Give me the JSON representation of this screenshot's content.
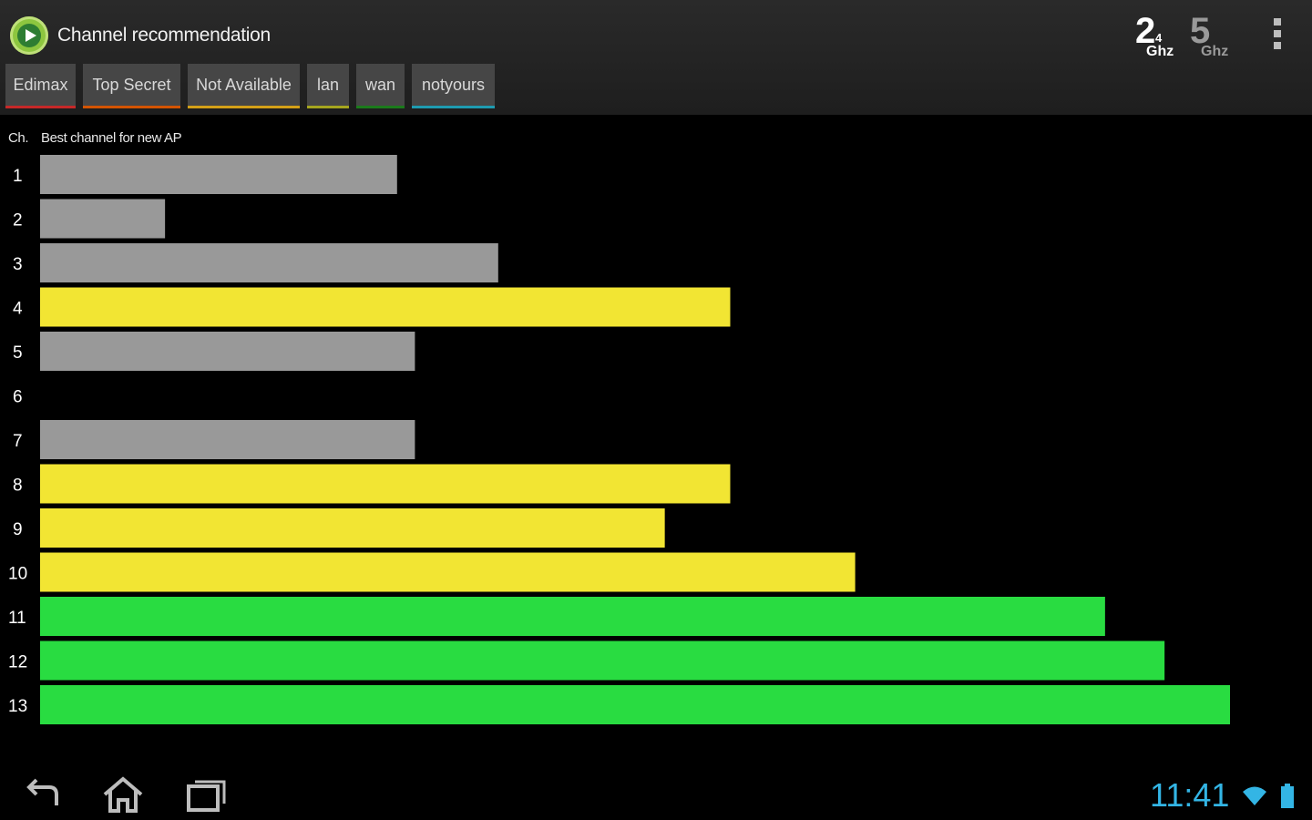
{
  "header": {
    "title": "Channel recommendation",
    "band_24": {
      "number": "2",
      "sub": "4",
      "unit": "Ghz"
    },
    "band_5": {
      "number": "5",
      "unit": "Ghz"
    }
  },
  "tabs": [
    {
      "label": "Edimax",
      "color": "#c62828"
    },
    {
      "label": "Top Secret",
      "color": "#d35400"
    },
    {
      "label": "Not Available",
      "color": "#d4a017"
    },
    {
      "label": "lan",
      "color": "#a6a61f"
    },
    {
      "label": "wan",
      "color": "#1b7a1b"
    },
    {
      "label": "notyours",
      "color": "#1e9bb0"
    }
  ],
  "chart_data": {
    "type": "bar",
    "orientation": "horizontal",
    "ch_label": "Ch.",
    "title": "Best channel for new AP",
    "categories": [
      "1",
      "2",
      "3",
      "4",
      "5",
      "6",
      "7",
      "8",
      "9",
      "10",
      "11",
      "12",
      "13"
    ],
    "values": [
      30,
      10.5,
      38.5,
      58,
      31.5,
      0,
      31.5,
      58,
      52.5,
      68.5,
      89.5,
      94.5,
      100
    ],
    "colors": [
      "#999999",
      "#999999",
      "#999999",
      "#f2e533",
      "#999999",
      "#999999",
      "#999999",
      "#f2e533",
      "#f2e533",
      "#f2e533",
      "#29dc41",
      "#29dc41",
      "#29dc41"
    ],
    "xlim": [
      0,
      100
    ]
  },
  "navbar": {
    "back_icon": "back-icon",
    "home_icon": "home-icon",
    "recents_icon": "recent-apps-icon",
    "clock": "11:41",
    "accent": "#33b5e5"
  }
}
